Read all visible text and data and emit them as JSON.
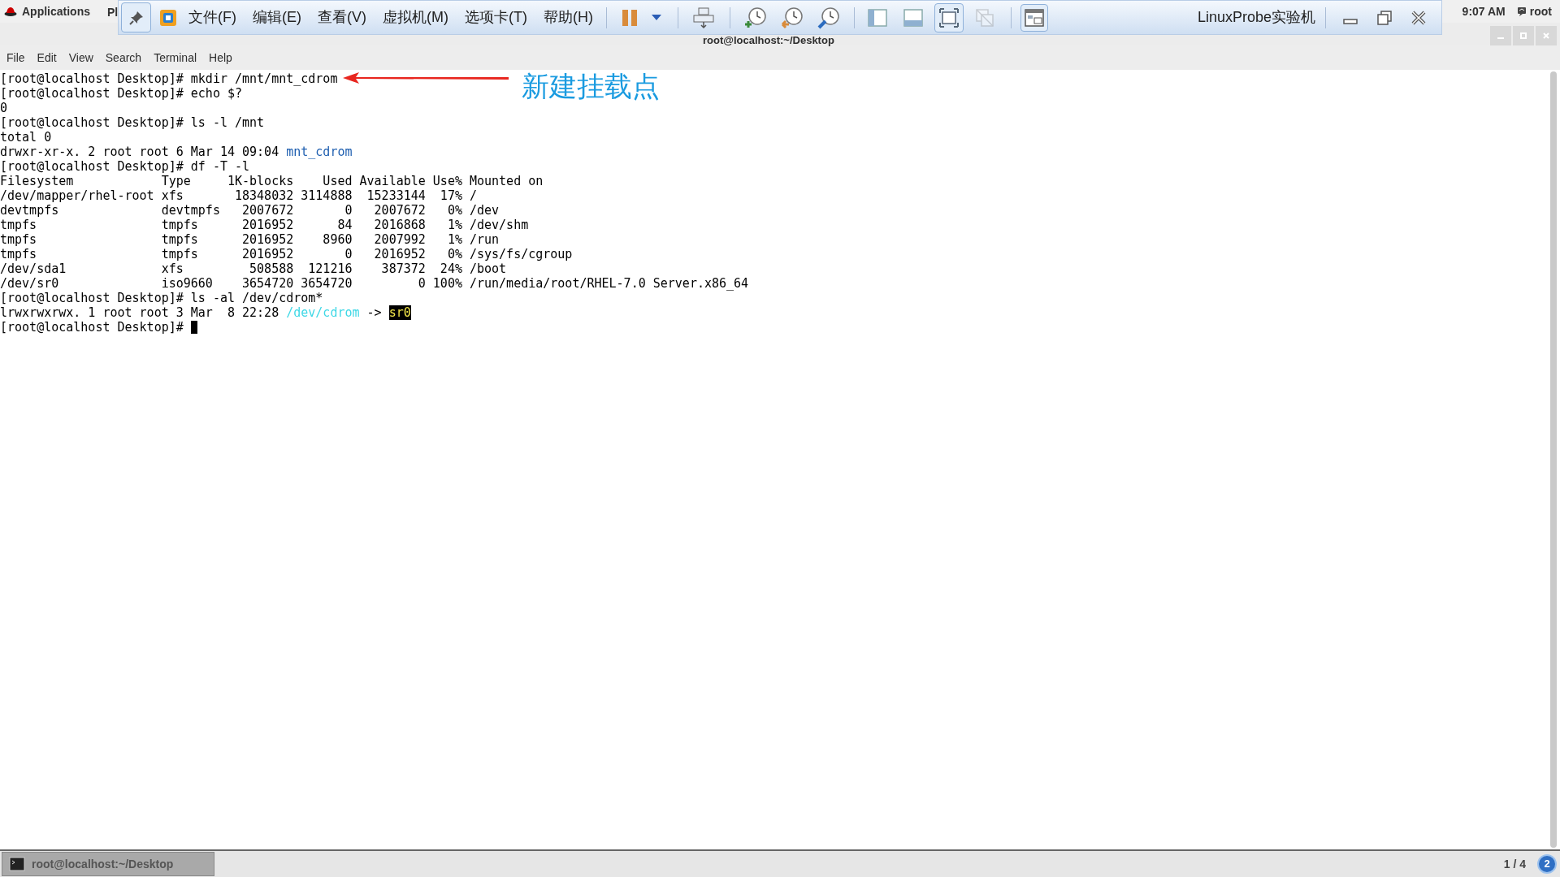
{
  "top_bar": {
    "applications": "Applications",
    "places": "Pl",
    "clock": "9:07 AM",
    "user": "root"
  },
  "vm_toolbar": {
    "pin": {
      "on": true
    },
    "menus": [
      "文件(F)",
      "编辑(E)",
      "查看(V)",
      "虚拟机(M)",
      "选项卡(T)",
      "帮助(H)"
    ],
    "view_buttons": [
      {
        "kind": "sidebar",
        "selected": false,
        "disabled": false
      },
      {
        "kind": "thumbnail",
        "selected": false,
        "disabled": false
      },
      {
        "kind": "fullscreen",
        "selected": true,
        "disabled": false
      },
      {
        "kind": "unity",
        "selected": false,
        "disabled": true
      }
    ],
    "console_view": {
      "on": true
    },
    "title": "LinuxProbe实验机"
  },
  "window": {
    "title": "root@localhost:~/Desktop"
  },
  "menu": [
    "File",
    "Edit",
    "View",
    "Search",
    "Terminal",
    "Help"
  ],
  "lines": [
    [
      {
        "kind": "text",
        "text": "[root@localhost Desktop]# mkdir /mnt/mnt_cdrom"
      }
    ],
    [
      {
        "kind": "text",
        "text": "[root@localhost Desktop]# echo $?"
      }
    ],
    [
      {
        "kind": "text",
        "text": "0"
      }
    ],
    [
      {
        "kind": "text",
        "text": "[root@localhost Desktop]# ls -l /mnt"
      }
    ],
    [
      {
        "kind": "text",
        "text": "total 0"
      }
    ],
    [
      {
        "kind": "text",
        "text": "drwxr-xr-x. 2 root root 6 Mar 14 09:04 "
      },
      {
        "kind": "dir",
        "text": "mnt_cdrom"
      }
    ],
    [
      {
        "kind": "text",
        "text": "[root@localhost Desktop]# df -T -l"
      }
    ],
    [
      {
        "kind": "text",
        "text": "Filesystem            Type     1K-blocks    Used Available Use% Mounted on"
      }
    ],
    [
      {
        "kind": "text",
        "text": "/dev/mapper/rhel-root xfs       18348032 3114888  15233144  17% /"
      }
    ],
    [
      {
        "kind": "text",
        "text": "devtmpfs              devtmpfs   2007672       0   2007672   0% /dev"
      }
    ],
    [
      {
        "kind": "text",
        "text": "tmpfs                 tmpfs      2016952      84   2016868   1% /dev/shm"
      }
    ],
    [
      {
        "kind": "text",
        "text": "tmpfs                 tmpfs      2016952    8960   2007992   1% /run"
      }
    ],
    [
      {
        "kind": "text",
        "text": "tmpfs                 tmpfs      2016952       0   2016952   0% /sys/fs/cgroup"
      }
    ],
    [
      {
        "kind": "text",
        "text": "/dev/sda1             xfs         508588  121216    387372  24% /boot"
      }
    ],
    [
      {
        "kind": "text",
        "text": "/dev/sr0              iso9660    3654720 3654720         0 100% /run/media/root/RHEL-7.0 Server.x86_64"
      }
    ],
    [
      {
        "kind": "text",
        "text": "[root@localhost Desktop]# ls -al /dev/cdrom*"
      }
    ],
    [
      {
        "kind": "text",
        "text": "lrwxrwxrwx. 1 root root 3 Mar  8 22:28 "
      },
      {
        "kind": "link",
        "text": "/dev/cdrom"
      },
      {
        "kind": "text",
        "text": " -> "
      },
      {
        "kind": "highlight",
        "text": "sr0"
      }
    ],
    [
      {
        "kind": "text",
        "text": "[root@localhost Desktop]# "
      }
    ]
  ],
  "annotation": {
    "text": "新建挂载点"
  },
  "taskbar": {
    "tasks": [
      {
        "label": "root@localhost:~/Desktop",
        "selected": true
      }
    ],
    "workspace": "1 / 4",
    "notifications": "2"
  }
}
